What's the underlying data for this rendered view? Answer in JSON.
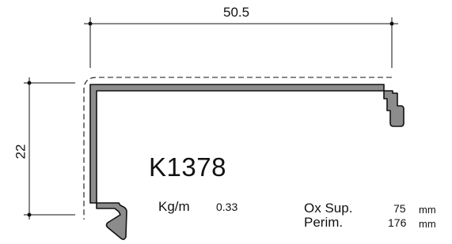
{
  "dimensions": {
    "width": "50.5",
    "height": "22"
  },
  "profile": {
    "code": "K1378",
    "weight_label": "Kg/m",
    "weight_value": "0.33",
    "ox_sup_label": "Ox Sup.",
    "ox_sup_value": "75",
    "ox_sup_unit": "mm",
    "perim_label": "Perim.",
    "perim_value": "176",
    "perim_unit": "mm"
  },
  "colors": {
    "profile_fill": "#8c8c8c",
    "stroke": "#111111",
    "background": "#ffffff"
  }
}
